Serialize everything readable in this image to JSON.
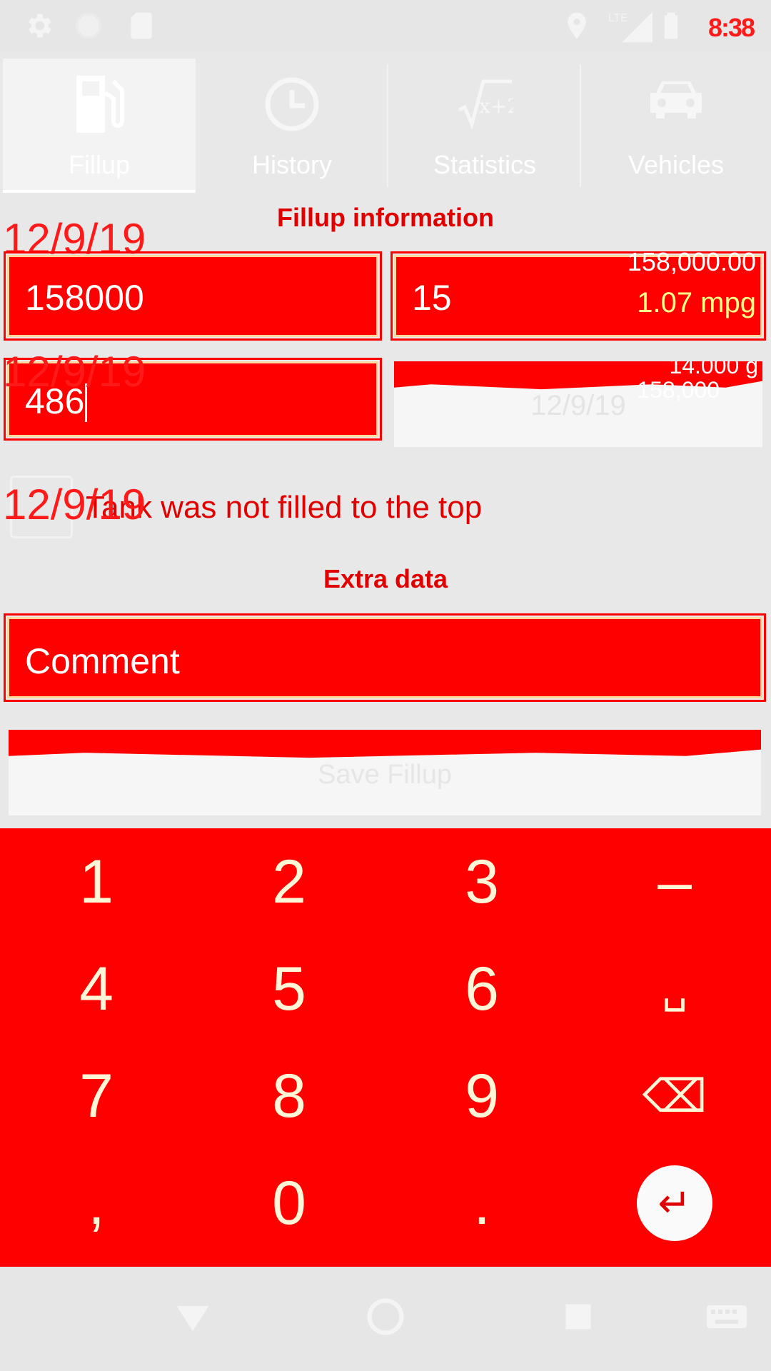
{
  "status_bar": {
    "time": "8:38",
    "icons": [
      "settings-icon",
      "circle-icon",
      "sd-card-icon",
      "location-icon",
      "lte-signal-icon",
      "battery-icon"
    ],
    "lte_label": "LTE"
  },
  "tabs": [
    {
      "label": "Fillup",
      "icon": "gas-pump-icon",
      "active": true
    },
    {
      "label": "History",
      "icon": "clock-icon",
      "active": false
    },
    {
      "label": "Statistics",
      "icon": "sqrt-icon",
      "active": false
    },
    {
      "label": "Vehicles",
      "icon": "car-icon",
      "active": false
    }
  ],
  "fillup": {
    "section_title": "Fillup information",
    "odometer_value": "158000",
    "odometer_date_overlay": "12/9/19",
    "gallons_value": "15",
    "gallons_hint_top": "158,000.00",
    "gallons_mpg": "1.07 mpg",
    "price_value": "486",
    "price_date_overlay": "12/9/19",
    "date_button_text": "12/9/19",
    "date_button_hint_top": "14.000 g",
    "date_button_hint_mid": "158,000"
  },
  "partial": {
    "label": "Tank was not filled to the top",
    "date_overlay": "12/9/19"
  },
  "extra": {
    "section_title": "Extra data",
    "comment_placeholder": "Comment"
  },
  "save_button_label": "Save Fillup",
  "keyboard": {
    "rows": [
      [
        "1",
        "2",
        "3",
        "–"
      ],
      [
        "4",
        "5",
        "6",
        "␣"
      ],
      [
        "7",
        "8",
        "9",
        "⌫"
      ],
      [
        ",",
        "0",
        ".",
        "↵"
      ]
    ]
  },
  "colors": {
    "accent": "#ff0000",
    "text_red": "#e00000",
    "keyboard_text": "#fff6d8"
  }
}
